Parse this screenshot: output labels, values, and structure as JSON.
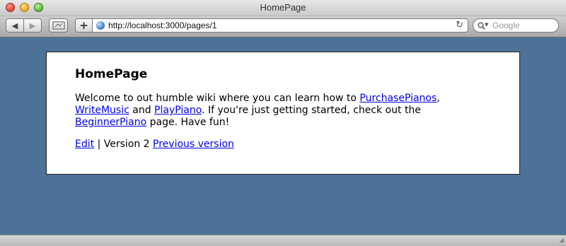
{
  "window": {
    "title": "HomePage"
  },
  "toolbar": {
    "url": "http://localhost:3000/pages/1",
    "search_placeholder": "Google",
    "back_icon": "◀",
    "forward_icon": "▶",
    "add_icon": "+",
    "reload_icon": "↻"
  },
  "page": {
    "title": "HomePage",
    "intro_1": "Welcome to out humble wiki where you can learn how to ",
    "link_purchase": "PurchasePianos",
    "sep_1": ",",
    "link_writemusic": "WriteMusic",
    "text_and": " and ",
    "link_playpiano": "PlayPiano",
    "text_mid": ". If you're just getting started, check out the ",
    "link_beginner": "BeginnerPiano",
    "text_end": " page. Have fun!",
    "edit_link": "Edit",
    "version_text": " | Version 2 ",
    "previous_link": "Previous version"
  },
  "colors": {
    "background": "#4c7297",
    "link": "#0000ee"
  }
}
